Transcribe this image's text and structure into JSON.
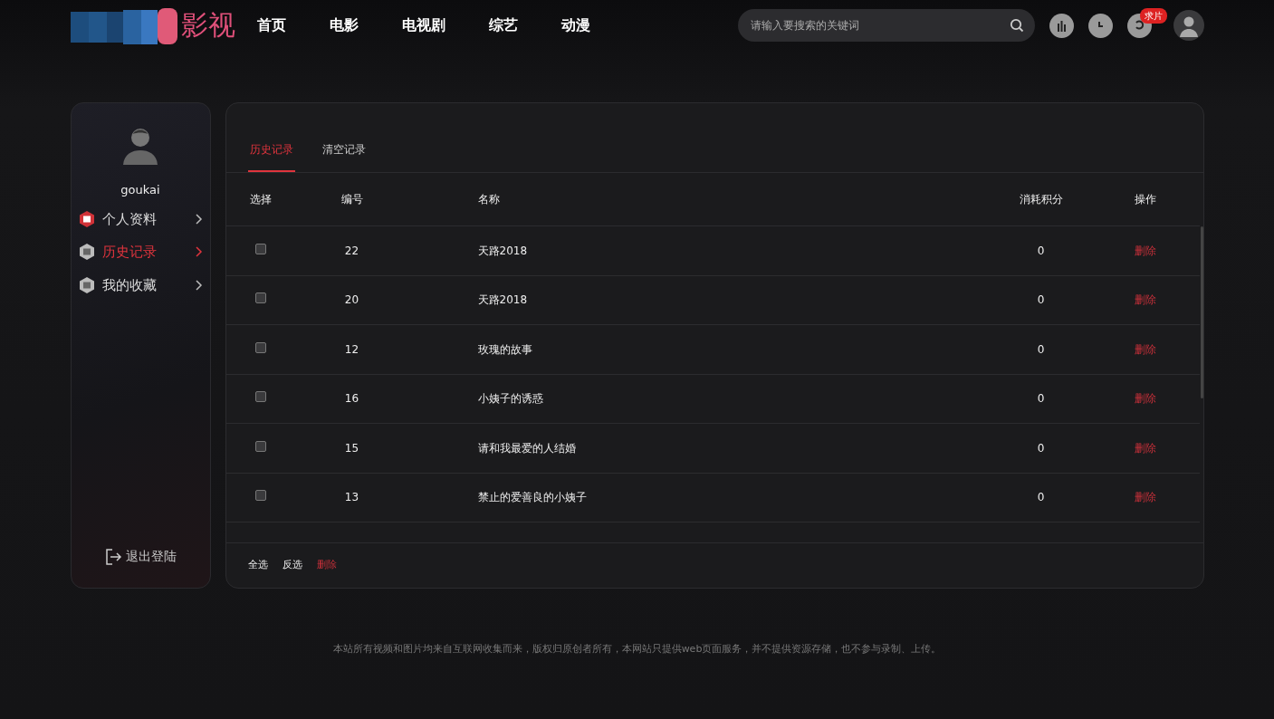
{
  "header": {
    "logo": "影视",
    "nav": [
      {
        "label": "首页"
      },
      {
        "label": "电影"
      },
      {
        "label": "电视剧"
      },
      {
        "label": "综艺"
      },
      {
        "label": "动漫"
      }
    ],
    "search": {
      "placeholder": "请输入要搜索的关键词"
    },
    "request_badge": "求片"
  },
  "sidebar": {
    "username": "goukai",
    "items": [
      {
        "label": "个人资料",
        "kind": "profile",
        "selected": false
      },
      {
        "label": "历史记录",
        "kind": "history",
        "selected": true
      },
      {
        "label": "我的收藏",
        "kind": "favorites",
        "selected": false
      }
    ],
    "logout": "退出登陆"
  },
  "tabs": [
    {
      "label": "历史记录",
      "selected": true
    },
    {
      "label": "清空记录",
      "selected": false
    }
  ],
  "table": {
    "columns": [
      "选择",
      "编号",
      "名称",
      "消耗积分",
      "操作"
    ],
    "rows": [
      {
        "checked": false,
        "id": "22",
        "name": "天路2018",
        "points": "0",
        "action": "删除"
      },
      {
        "checked": false,
        "id": "20",
        "name": "天路2018",
        "points": "0",
        "action": "删除"
      },
      {
        "checked": false,
        "id": "12",
        "name": "玫瑰的故事",
        "points": "0",
        "action": "删除"
      },
      {
        "checked": false,
        "id": "16",
        "name": "小姨子的诱惑",
        "points": "0",
        "action": "删除"
      },
      {
        "checked": false,
        "id": "15",
        "name": "请和我最爱的人结婚",
        "points": "0",
        "action": "删除"
      },
      {
        "checked": false,
        "id": "13",
        "name": "禁止的爱善良的小姨子",
        "points": "0",
        "action": "删除"
      }
    ]
  },
  "bulk_actions": [
    {
      "label": "全选",
      "kind": "plain"
    },
    {
      "label": "反选",
      "kind": "plain"
    },
    {
      "label": "删除",
      "kind": "danger"
    }
  ],
  "footer": "本站所有视频和图片均来自互联网收集而来，版权归原创者所有，本网站只提供web页面服务，并不提供资源存储，也不参与录制、上传。"
}
